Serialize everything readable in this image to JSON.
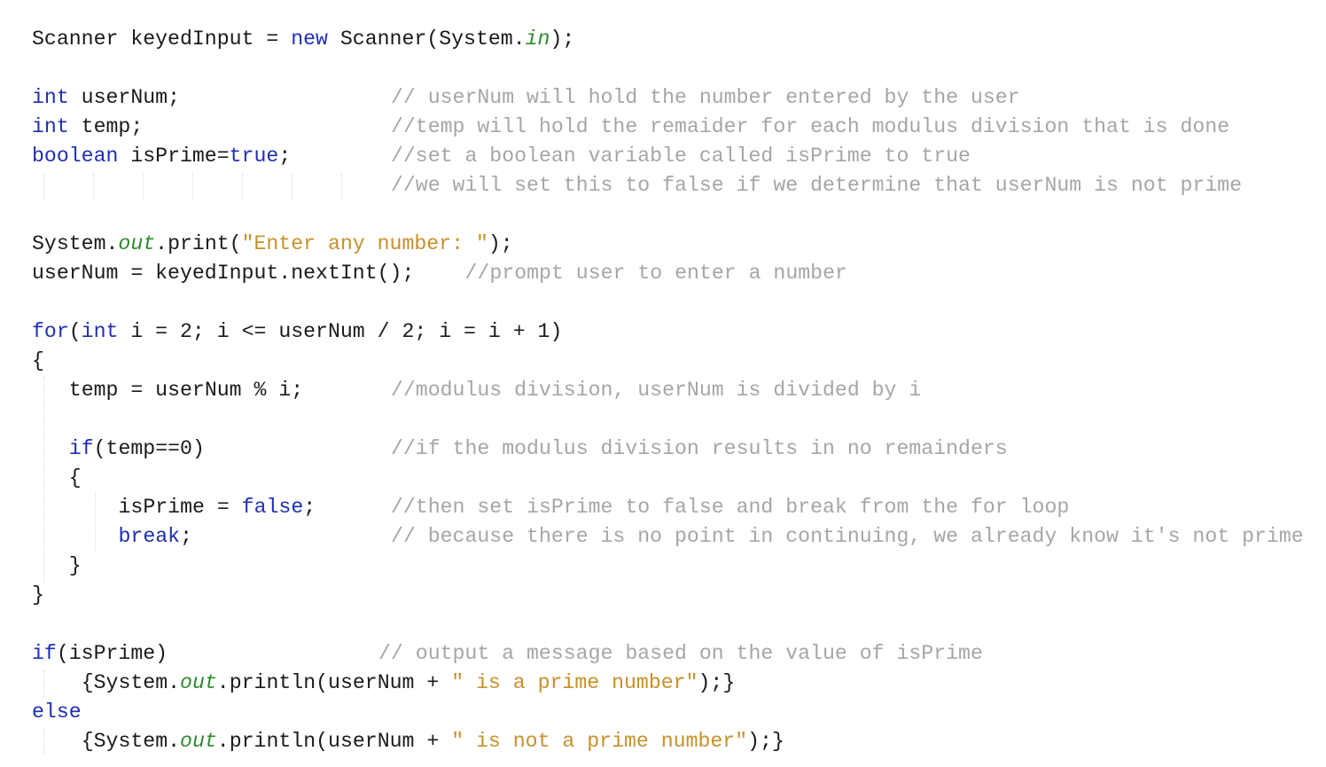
{
  "editor": {
    "language": "Java",
    "lines": [
      {
        "id": "l1",
        "indent": 0,
        "tokens": [
          {
            "t": "plain",
            "v": "Scanner keyedInput = "
          },
          {
            "t": "kw",
            "v": "new"
          },
          {
            "t": "plain",
            "v": " Scanner(System."
          },
          {
            "t": "fld",
            "v": "in"
          },
          {
            "t": "plain",
            "v": ");"
          }
        ]
      },
      {
        "id": "l2",
        "indent": 0,
        "tokens": []
      },
      {
        "id": "l3",
        "indent": 0,
        "comment_col": 29,
        "tokens": [
          {
            "t": "kw",
            "v": "int"
          },
          {
            "t": "plain",
            "v": " userNum;"
          }
        ],
        "comment": "// userNum will hold the number entered by the user"
      },
      {
        "id": "l4",
        "indent": 0,
        "comment_col": 29,
        "tokens": [
          {
            "t": "kw",
            "v": "int"
          },
          {
            "t": "plain",
            "v": " temp;"
          }
        ],
        "comment": "//temp will hold the remaider for each modulus division that is done"
      },
      {
        "id": "l5",
        "indent": 0,
        "comment_col": 29,
        "tokens": [
          {
            "t": "kw",
            "v": "boolean"
          },
          {
            "t": "plain",
            "v": " isPrime="
          },
          {
            "t": "kw",
            "v": "true"
          },
          {
            "t": "plain",
            "v": ";"
          }
        ],
        "comment": "//set a boolean variable called isPrime to true"
      },
      {
        "id": "l6",
        "indent": 0,
        "comment_col": 29,
        "tokens": [],
        "comment": "//we will set this to false if we determine that userNum is not prime"
      },
      {
        "id": "l7",
        "indent": 0,
        "tokens": []
      },
      {
        "id": "l8",
        "indent": 0,
        "tokens": [
          {
            "t": "plain",
            "v": "System."
          },
          {
            "t": "fld",
            "v": "out"
          },
          {
            "t": "plain",
            "v": ".print("
          },
          {
            "t": "str",
            "v": "\"Enter any number: \""
          },
          {
            "t": "plain",
            "v": ");"
          }
        ]
      },
      {
        "id": "l9",
        "indent": 0,
        "comment_col": 35,
        "tokens": [
          {
            "t": "plain",
            "v": "userNum = keyedInput.nextInt();"
          }
        ],
        "comment": "//prompt user to enter a number"
      },
      {
        "id": "l10",
        "indent": 0,
        "tokens": []
      },
      {
        "id": "l11",
        "indent": 0,
        "tokens": [
          {
            "t": "kw",
            "v": "for"
          },
          {
            "t": "plain",
            "v": "("
          },
          {
            "t": "kw",
            "v": "int"
          },
          {
            "t": "plain",
            "v": " i = 2; i <= userNum / 2; i = i + 1)"
          }
        ]
      },
      {
        "id": "l12",
        "indent": 0,
        "tokens": [
          {
            "t": "plain",
            "v": "{"
          }
        ]
      },
      {
        "id": "l13",
        "indent": 3,
        "comment_col": 29,
        "tokens": [
          {
            "t": "plain",
            "v": "temp = userNum % i;"
          }
        ],
        "comment": "//modulus division, userNum is divided by i"
      },
      {
        "id": "l14",
        "indent": 0,
        "tokens": []
      },
      {
        "id": "l15",
        "indent": 3,
        "comment_col": 29,
        "tokens": [
          {
            "t": "kw",
            "v": "if"
          },
          {
            "t": "plain",
            "v": "(temp==0)"
          }
        ],
        "comment": "//if the modulus division results in no remainders"
      },
      {
        "id": "l16",
        "indent": 3,
        "tokens": [
          {
            "t": "plain",
            "v": "{"
          }
        ]
      },
      {
        "id": "l17",
        "indent": 7,
        "comment_col": 29,
        "tokens": [
          {
            "t": "plain",
            "v": "isPrime = "
          },
          {
            "t": "kw",
            "v": "false"
          },
          {
            "t": "plain",
            "v": ";"
          }
        ],
        "comment": "//then set isPrime to false and break from the for loop"
      },
      {
        "id": "l18",
        "indent": 7,
        "comment_col": 29,
        "tokens": [
          {
            "t": "kw",
            "v": "break"
          },
          {
            "t": "plain",
            "v": ";"
          }
        ],
        "comment": "// because there is no point in continuing, we already know it's not prime"
      },
      {
        "id": "l19",
        "indent": 3,
        "tokens": [
          {
            "t": "plain",
            "v": "}"
          }
        ]
      },
      {
        "id": "l20",
        "indent": 0,
        "tokens": [
          {
            "t": "plain",
            "v": "}"
          }
        ]
      },
      {
        "id": "l21",
        "indent": 0,
        "tokens": []
      },
      {
        "id": "l22",
        "indent": 0,
        "comment_col": 28,
        "tokens": [
          {
            "t": "kw",
            "v": "if"
          },
          {
            "t": "plain",
            "v": "(isPrime)"
          }
        ],
        "comment": "// output a message based on the value of isPrime"
      },
      {
        "id": "l23",
        "indent": 4,
        "tokens": [
          {
            "t": "plain",
            "v": "{System."
          },
          {
            "t": "fld",
            "v": "out"
          },
          {
            "t": "plain",
            "v": ".println(userNum + "
          },
          {
            "t": "str",
            "v": "\" is a prime number\""
          },
          {
            "t": "plain",
            "v": ");}"
          }
        ]
      },
      {
        "id": "l24",
        "indent": 0,
        "tokens": [
          {
            "t": "kw",
            "v": "else"
          }
        ]
      },
      {
        "id": "l25",
        "indent": 4,
        "tokens": [
          {
            "t": "plain",
            "v": "{System."
          },
          {
            "t": "fld",
            "v": "out"
          },
          {
            "t": "plain",
            "v": ".println(userNum + "
          },
          {
            "t": "str",
            "v": "\" is not a prime number\""
          },
          {
            "t": "plain",
            "v": ");}"
          }
        ]
      }
    ]
  },
  "colors": {
    "keyword": "#1f2fb0",
    "string": "#c8902a",
    "field": "#2e8a2e",
    "comment": "#a6a6a6",
    "text": "#1a1a1a",
    "background": "#ffffff"
  }
}
